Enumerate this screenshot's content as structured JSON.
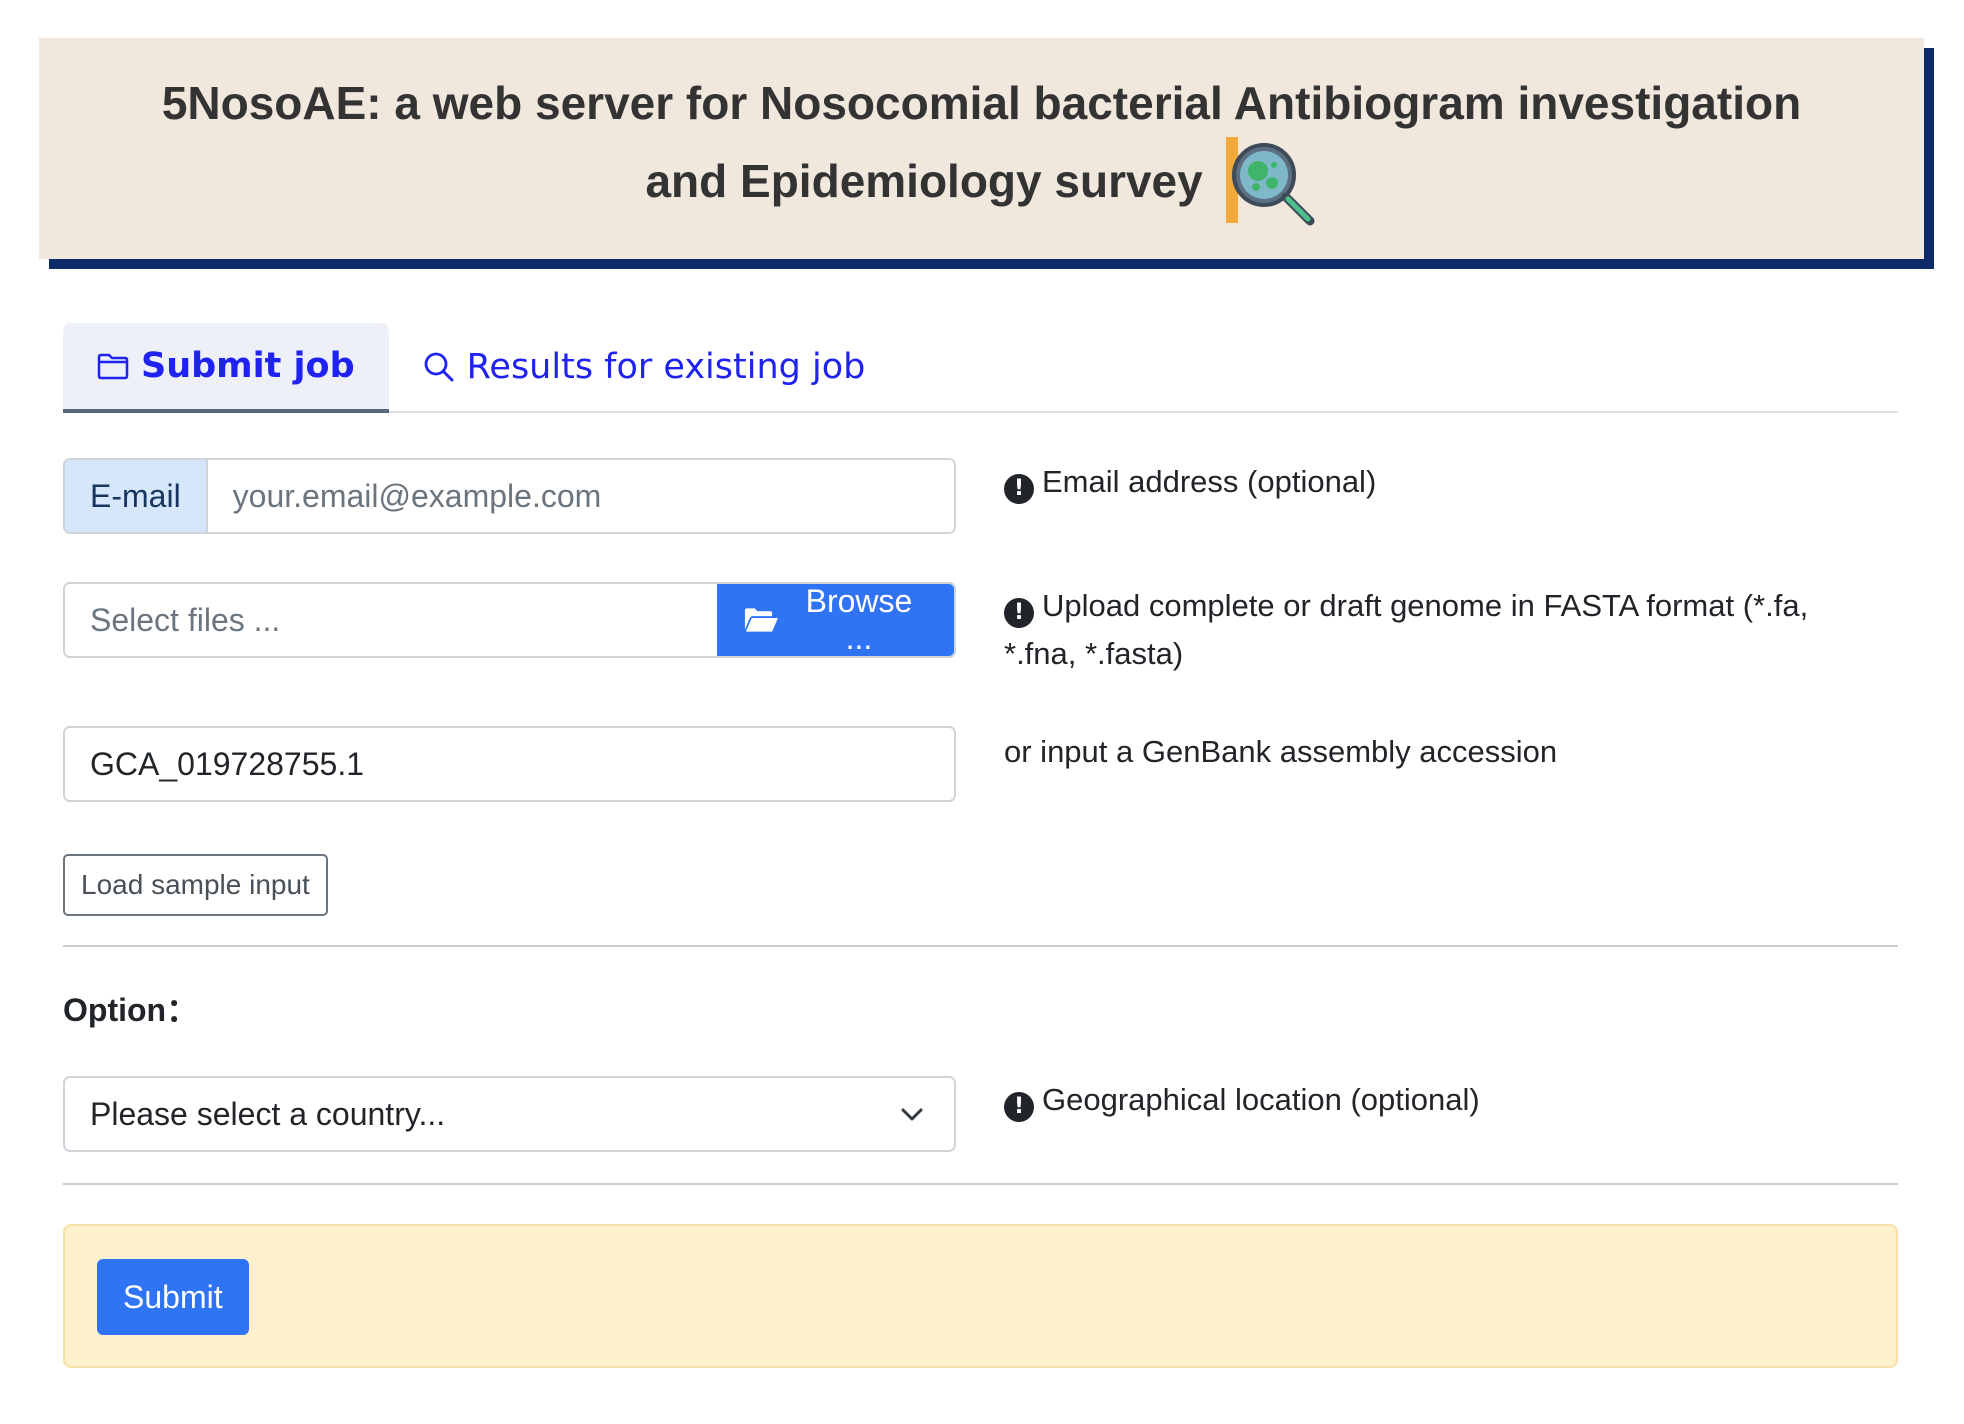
{
  "header": {
    "title_line1": "5NosoAE: a web server for Nosocomial bacterial Antibiogram investigation",
    "title_line2": "and Epidemiology survey",
    "logo_icon": "bacteria-magnifier-icon",
    "background": "#f0e7dd",
    "shadow_color": "#0d2b66"
  },
  "tabs": [
    {
      "label": "Submit job",
      "icon": "folder-icon",
      "active": true
    },
    {
      "label": "Results for existing job",
      "icon": "search-icon",
      "active": false
    }
  ],
  "form": {
    "email": {
      "addon_label": "E-mail",
      "placeholder": "your.email@example.com",
      "value": "",
      "help": "Email address (optional)"
    },
    "file": {
      "placeholder": "Select files ...",
      "button_label": "Browse ...",
      "help": "Upload complete or draft genome in FASTA format (*.fa, *.fna, *.fasta)"
    },
    "accession": {
      "value": "GCA_019728755.1",
      "help": "or input a GenBank assembly accession"
    },
    "sample_button": "Load sample input"
  },
  "option": {
    "label": "Option：",
    "country_select": {
      "selected": "Please select a country...",
      "help": "Geographical location (optional)"
    }
  },
  "submit": {
    "label": "Submit"
  },
  "colors": {
    "accent": "#2f74f5",
    "tab_text": "#1f22f0",
    "submit_panel": "#fdf0cd"
  }
}
